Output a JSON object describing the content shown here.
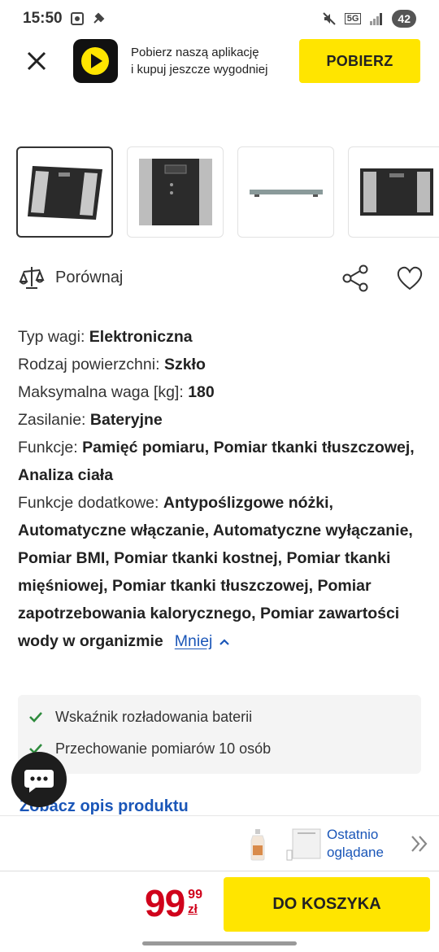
{
  "status_bar": {
    "time": "15:50",
    "network": "5G",
    "battery": "42",
    "icons": [
      "screenshot-icon",
      "tools-icon",
      "mute-icon",
      "signal-icon",
      "battery-icon"
    ]
  },
  "app_banner": {
    "text_line1": "Pobierz naszą aplikację",
    "text_line2": "i kupuj jeszcze wygodniej",
    "button_label": "POBIERZ",
    "accent": "#ffe500"
  },
  "thumbnails": [
    {
      "label": "scale-front-angled",
      "selected": true
    },
    {
      "label": "scale-top-closeup",
      "selected": false
    },
    {
      "label": "scale-side-view",
      "selected": false
    },
    {
      "label": "scale-front",
      "selected": false
    }
  ],
  "actions": {
    "compare_label": "Porównaj"
  },
  "specs": [
    {
      "label": "Typ wagi:",
      "value": "Elektroniczna"
    },
    {
      "label": "Rodzaj powierzchni:",
      "value": "Szkło"
    },
    {
      "label": "Maksymalna waga [kg]:",
      "value": "180"
    },
    {
      "label": "Zasilanie:",
      "value": "Bateryjne"
    },
    {
      "label": "Funkcje:",
      "value": "Pamięć pomiaru, Pomiar tkanki tłuszczowej, Analiza ciała"
    },
    {
      "label": "Funkcje dodatkowe:",
      "value": "Antypoślizgowe nóżki, Automatyczne włączanie, Automatyczne wyłączanie, Pomiar BMI, Pomiar tkanki kostnej, Pomiar tkanki mięśniowej, Pomiar tkanki tłuszczowej, Pomiar zapotrzebowania kalorycznego, Pomiar zawartości wody w organizmie"
    }
  ],
  "less_link": "Mniej",
  "features": [
    "Wskaźnik rozładowania baterii",
    "Przechowanie pomiarów 10 osób"
  ],
  "product_description_link": "Zobacz opis produktu",
  "recently_viewed": {
    "label_line1": "Ostatnio",
    "label_line2": "oglądane"
  },
  "cart": {
    "price_main": "99",
    "price_cents": "99",
    "currency": "zł",
    "button_label": "DO KOSZYKA",
    "price_color": "#d0021b"
  }
}
